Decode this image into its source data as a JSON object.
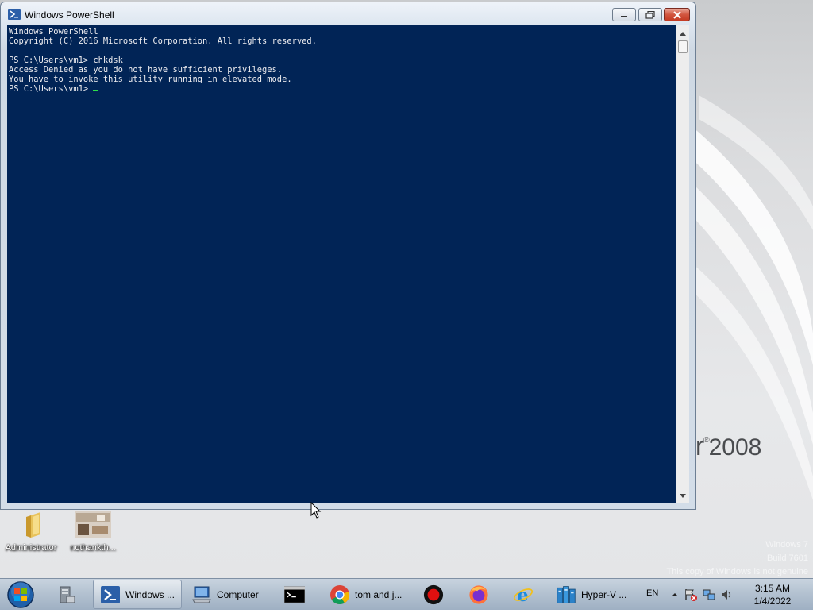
{
  "window": {
    "title": "Windows PowerShell",
    "console_lines": [
      "Windows PowerShell",
      "Copyright (C) 2016 Microsoft Corporation. All rights reserved.",
      "",
      "PS C:\\Users\\vm1> chkdsk",
      "Access Denied as you do not have sufficient privileges.",
      "You have to invoke this utility running in elevated mode.",
      "PS C:\\Users\\vm1> "
    ]
  },
  "desktop": {
    "brand_text": "er",
    "brand_year": "2008",
    "icons": [
      {
        "label": "Administrator",
        "icon": "folder-icon"
      },
      {
        "label": "nothankth...",
        "icon": "image-thumbnail-icon"
      }
    ],
    "watermark": [
      "Windows 7",
      "Build 7601",
      "This copy of Windows is not genuine"
    ]
  },
  "taskbar": {
    "items": [
      {
        "label": "",
        "icon": "server-manager-icon"
      },
      {
        "label": "Windows ...",
        "icon": "powershell-icon",
        "active": true
      },
      {
        "label": "Computer",
        "icon": "computer-icon"
      },
      {
        "label": "",
        "icon": "cmd-icon"
      },
      {
        "label": "tom and j...",
        "icon": "chrome-icon"
      },
      {
        "label": "",
        "icon": "record-icon"
      },
      {
        "label": "",
        "icon": "firefox-icon"
      },
      {
        "label": "",
        "icon": "internet-explorer-icon"
      },
      {
        "label": "Hyper-V ...",
        "icon": "hyper-v-icon"
      }
    ],
    "language": "EN",
    "clock_time": "3:15 AM",
    "clock_date": "1/4/2022"
  },
  "colors": {
    "console_bg": "#012456",
    "console_text": "#eeedf0",
    "cursor": "#2ee04a"
  }
}
